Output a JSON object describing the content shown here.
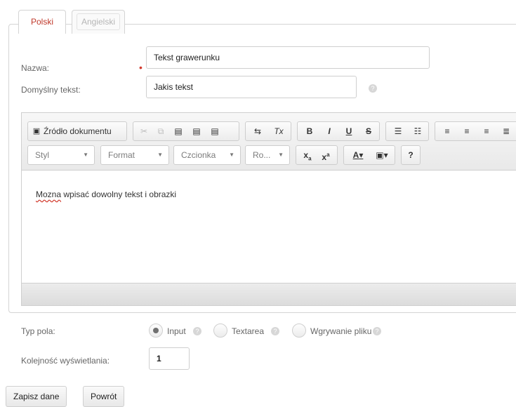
{
  "tabs": {
    "active": "Polski",
    "inactive": "Angielski"
  },
  "form": {
    "name_label": "Nazwa:",
    "name_value": "Tekst grawerunku",
    "required_mark": "•",
    "default_text_label": "Domyślny tekst:",
    "default_text_value": "Jakis tekst",
    "help_glyph": "?"
  },
  "editor": {
    "toolbar": {
      "source_label": "Źródło dokumentu",
      "bold": "B",
      "italic": "I",
      "underline": "U",
      "strike": "S",
      "help": "?",
      "style_label": "Styl",
      "format_label": "Format",
      "font_label": "Czcionka",
      "size_label": "Ro...",
      "text_color": "A",
      "combo_arrow": "▼"
    },
    "content_spell": "Mozna",
    "content_rest": " wpisać dowolny tekst i obrazki"
  },
  "field_type": {
    "label": "Typ pola:",
    "options": [
      {
        "label": "Input",
        "checked": true
      },
      {
        "label": "Textarea",
        "checked": false
      },
      {
        "label": "Wgrywanie pliku",
        "checked": false
      }
    ]
  },
  "order": {
    "label": "Kolejność wyświetlania:",
    "value": "1"
  },
  "buttons": {
    "save": "Zapisz dane",
    "back": "Powrót"
  }
}
